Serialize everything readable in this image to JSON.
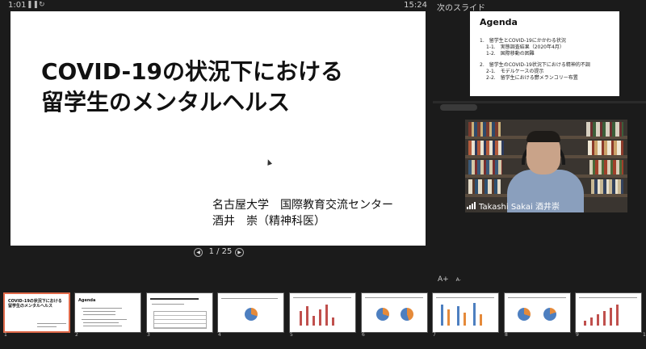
{
  "topbar": {
    "elapsed": "1:01",
    "pause_icon": "pause-icon",
    "reset_icon": "reset-icon",
    "clock": "15:24",
    "next_slide_label": "次のスライド"
  },
  "main_slide": {
    "title_line1": "COVID-19の状況下における",
    "title_line2": "留学生のメンタルヘルス",
    "affil_line1": "名古屋大学　国際教育交流センター",
    "affil_line2": "酒井　崇（精神科医）"
  },
  "pager": {
    "prev_icon": "◀",
    "next_icon": "▶",
    "page": "1 / 25"
  },
  "next_slide": {
    "title": "Agenda",
    "items": [
      "1.　留学生とCOVID-19にかかわる状況",
      "1-1.　実態調査結果（2020年4月）",
      "1-2.　国際移動の困難",
      "2.　留学生のCOVID-19状況下における精神的不調",
      "2-1.　モデルケースの提示",
      "2-2.　留学生における鬱メランコリー布置"
    ]
  },
  "video": {
    "name": "Takashi Sakai 酒井崇"
  },
  "font_ctrl": {
    "increase": "A+",
    "decrease": "A-"
  },
  "filmstrip": {
    "numbers": [
      "1",
      "2",
      "3",
      "4",
      "5",
      "6",
      "7",
      "8",
      "9",
      "10"
    ],
    "thumb1_title": "COVID-19の状況下における\n留学生のメンタルヘルス",
    "thumb2_title": "Agenda"
  },
  "colors": {
    "accent": "#e06a4a",
    "background": "#1b1b1b"
  }
}
